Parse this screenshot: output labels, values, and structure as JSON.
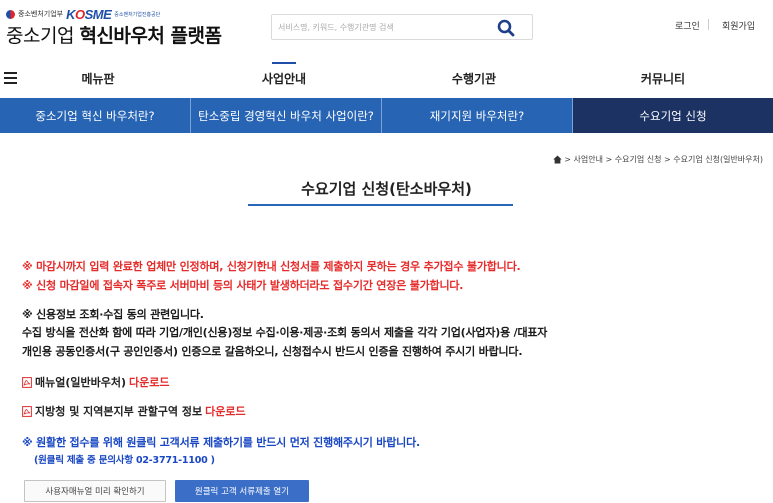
{
  "header": {
    "ministry": "중소벤처기업부",
    "brand_k": "K",
    "brand_o": "O",
    "brand_rest": "SME",
    "agency": "중소벤처기업진흥공단",
    "title_light": "중소기업",
    "title_bold": "혁신바우처 플랫폼",
    "search_placeholder": "서비스명, 키워드, 수행기관명 검색",
    "login": "로그인",
    "signup": "회원가입"
  },
  "gnb": {
    "items": [
      "메뉴판",
      "사업안내",
      "수행기관",
      "커뮤니티"
    ]
  },
  "subnav": {
    "items": [
      "중소기업 혁신 바우처란?",
      "탄소중립 경영혁신 바우처 사업이란?",
      "재기지원 바우처란?",
      "수요기업 신청"
    ]
  },
  "breadcrumb": {
    "text": "> 사업안내 > 수요기업 신청 > 수요기업 신청(일반바우처)"
  },
  "page": {
    "title": "수요기업 신청(탄소바우처)",
    "notice1": "※ 마감시까지 입력 완료한 업체만 인정하며, 신청기한내 신청서를 제출하지 못하는 경우 추가접수 불가합니다.",
    "notice2": "※ 신청 마감일에 접속자 폭주로 서버마비 등의 사태가 발생하더라도 접수기간 연장은 불가합니다.",
    "consent_title": "※ 신용정보 조회·수집 동의 관련입니다.",
    "consent_line1": "수집 방식을 전산화 함에 따라 기업/개인(신용)정보 수집·이용·제공·조회 동의서 제출을 각각 기업(사업자)용 /대표자",
    "consent_line2": "개인용 공동인증서(구 공인인증서) 인증으로 갈음하오니, 신청접수시 반드시 인증을 진행하여 주시기 바랍니다.",
    "manual_label": "매뉴얼(일반바우처)",
    "manual_link": "다운로드",
    "region_label": "지방청 및 지역본지부 관할구역 정보",
    "region_link": "다운로드",
    "oneclick_notice": "※ 원활한 접수를 위해 원클릭 고객서류 제출하기를 반드시 먼저 진행해주시기 바랍니다.",
    "oneclick_contact": "(원클릭 제출 중 문의사항 02-3771-1100 )",
    "btn_manual_preview": "사용자매뉴얼 미리 확인하기",
    "btn_oneclick": "원클릭 고객 서류제출 열기"
  },
  "colors": {
    "subnav_bg": "#2764b4",
    "subnav_active": "#1b3263",
    "notice_red": "#e62b2b",
    "notice_blue": "#1a48c4",
    "button_blue": "#3a6ec7"
  }
}
